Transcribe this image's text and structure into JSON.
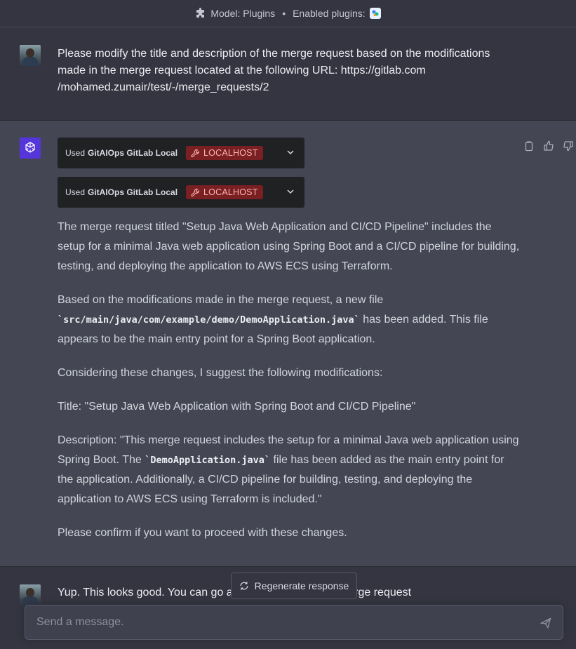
{
  "topbar": {
    "model_label": "Model: Plugins",
    "separator": "•",
    "plugins_label": "Enabled plugins:"
  },
  "messages": {
    "user1": {
      "text": "Please modify the title and description of the merge request based on the modifications made in the merge request located at the following URL: https://gitlab.com /mohamed.zumair/test/-/merge_requests/2"
    },
    "assistant": {
      "plugin_calls": [
        {
          "prefix": "Used",
          "name": "GitAIOps GitLab Local",
          "badge": "LOCALHOST"
        },
        {
          "prefix": "Used",
          "name": "GitAIOps GitLab Local",
          "badge": "LOCALHOST"
        }
      ],
      "p1": "The merge request titled \"Setup Java Web Application and CI/CD Pipeline\" includes the setup for a minimal Java web application using Spring Boot and a CI/CD pipeline for building, testing, and deploying the application to AWS ECS using Terraform.",
      "p2_before": "Based on the modifications made in the merge request, a new file ",
      "p2_code": "`src/main/java/com/example/demo/DemoApplication.java`",
      "p2_after": " has been added. This file appears to be the main entry point for a Spring Boot application.",
      "p3": "Considering these changes, I suggest the following modifications:",
      "p4": "Title: \"Setup Java Web Application with Spring Boot and CI/CD Pipeline\"",
      "p5_before": "Description: \"This merge request includes the setup for a minimal Java web application using Spring Boot. The ",
      "p5_code": "`DemoApplication.java`",
      "p5_after": " file has been added as the main entry point for the application. Additionally, a CI/CD pipeline for building, testing, and deploying the application to AWS ECS using Terraform is included.\"",
      "p6": "Please confirm if you want to proceed with these changes."
    },
    "user2": {
      "text": "Yup. This looks good. You can go ahead and update the merge request"
    }
  },
  "regenerate_label": "Regenerate response",
  "composer": {
    "placeholder": "Send a message."
  }
}
